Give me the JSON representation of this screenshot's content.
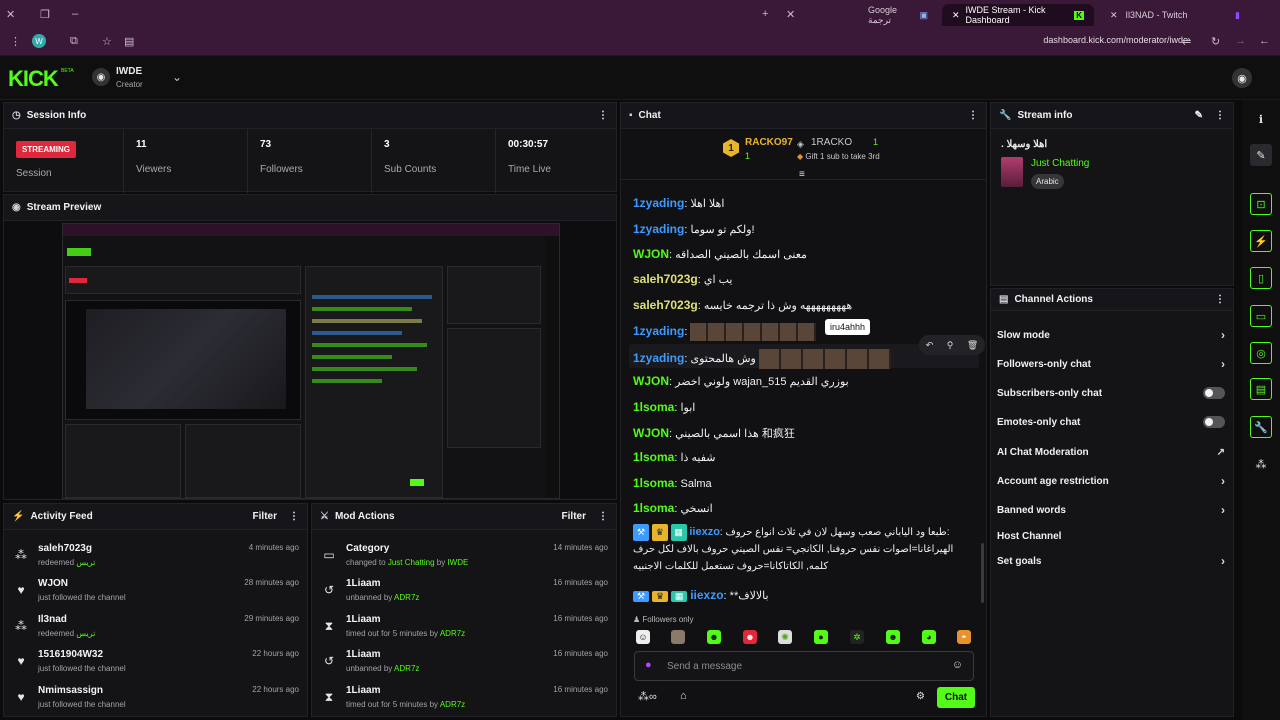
{
  "browser": {
    "tabs": [
      {
        "label": "Google ترجمة"
      },
      {
        "label": "IWDE Stream - Kick Dashboard"
      },
      {
        "label": "Il3NAD - Twitch"
      }
    ],
    "url": "dashboard.kick.com/moderator/iwde",
    "profile_letter": "W"
  },
  "header": {
    "logo": "KICK",
    "logo_badge": "BETA",
    "channel_name": "IWDE",
    "channel_role": "Creator"
  },
  "session": {
    "title": "Session Info",
    "status_badge": "STREAMING",
    "status_label": "Session",
    "stats": [
      {
        "value": "11",
        "label": "Viewers"
      },
      {
        "value": "73",
        "label": "Followers"
      },
      {
        "value": "3",
        "label": "Sub Counts"
      },
      {
        "value": "00:30:57",
        "label": "Time Live"
      }
    ]
  },
  "preview": {
    "title": "Stream Preview"
  },
  "activity": {
    "title": "Activity Feed",
    "filter_label": "Filter",
    "items": [
      {
        "name": "saleh7023g",
        "sub": "redeemed",
        "reward": "تريس",
        "time": "4 minutes ago",
        "icon": "redeem-icon"
      },
      {
        "name": "WJON",
        "sub": "just followed the channel",
        "reward": "",
        "time": "28 minutes ago",
        "icon": "heart-icon"
      },
      {
        "name": "Il3nad",
        "sub": "redeemed",
        "reward": "تريس",
        "time": "29 minutes ago",
        "icon": "redeem-icon"
      },
      {
        "name": "15161904W32",
        "sub": "just followed the channel",
        "reward": "",
        "time": "22 hours ago",
        "icon": "heart-icon"
      },
      {
        "name": "Nmimsassign",
        "sub": "just followed the channel",
        "reward": "",
        "time": "22 hours ago",
        "icon": "heart-icon"
      }
    ]
  },
  "mod": {
    "title": "Mod Actions",
    "filter_label": "Filter",
    "items": [
      {
        "name": "Category",
        "pre": "changed to",
        "target": "Just Chatting",
        "mid": "by",
        "by": "IWDE",
        "time": "14 minutes ago"
      },
      {
        "name": "1Liaam",
        "pre": "unbanned by",
        "target": "ADR7z",
        "mid": "",
        "by": "",
        "time": "16 minutes ago"
      },
      {
        "name": "1Liaam",
        "pre": "timed out for 5 minutes by",
        "target": "ADR7z",
        "mid": "",
        "by": "",
        "time": "16 minutes ago"
      },
      {
        "name": "1Liaam",
        "pre": "unbanned by",
        "target": "ADR7z",
        "mid": "",
        "by": "",
        "time": "16 minutes ago"
      },
      {
        "name": "1Liaam",
        "pre": "timed out for 5 minutes by",
        "target": "ADR7z",
        "mid": "",
        "by": "",
        "time": "16 minutes ago"
      }
    ]
  },
  "chat": {
    "title": "Chat",
    "leader1_name": "RACKO97",
    "leader1_count": "1",
    "leader2_name": "1RACKO",
    "leader2_count": "1",
    "gift_text": "Gift 1 sub to take 3rd",
    "messages": [
      {
        "user": "1zyading",
        "text": "اهلا اهلا",
        "color": "#3d9bff"
      },
      {
        "user": "1zyading",
        "text": "ولكم تو سوما!",
        "color": "#3d9bff"
      },
      {
        "user": "WJON",
        "text": "معنى اسمك بالصيني الصداقه",
        "color": "#53fc18"
      },
      {
        "user": "saleh7023g",
        "text": "يب اي",
        "color": "#dfe07a"
      },
      {
        "user": "saleh7023g",
        "text": "هههههههههه وش ذا ترجمه خايسه",
        "color": "#dfe07a"
      },
      {
        "user": "1zyading",
        "text": "",
        "color": "#3d9bff"
      },
      {
        "user": "1zyading",
        "text": "وش هالمحتوى",
        "color": "#3d9bff"
      },
      {
        "user": "WJON",
        "text": "ولوني اخضر wajan_515 بوزري القديم",
        "color": "#53fc18"
      },
      {
        "user": "1lsoma",
        "text": "ابوا",
        "color": "#53fc18"
      },
      {
        "user": "WJON",
        "text": "هذا اسمي بالصيني 和疯狂",
        "color": "#53fc18"
      },
      {
        "user": "1lsoma",
        "text": "شفيه ذا",
        "color": "#53fc18"
      },
      {
        "user": "1lsoma",
        "text": "Salma",
        "color": "#53fc18"
      },
      {
        "user": "1lsoma",
        "text": "انسخي",
        "color": "#53fc18"
      }
    ],
    "long_msg_user": "iiexzo",
    "long_msg_lines": [
      "طبعا ود الياباني صعب وسهل لان في ثلاث انواع حروف:",
      "الهيراغانا=اصوات نفس حروفنا, الكانجي= نفس الصيني حروف بالاف لكل حرف",
      "كلمه, الكاتاكانا=حروف تستعمل للكلمات الاجنبيه"
    ],
    "last_msg_user": "iiexzo",
    "last_msg_text": "**بالالاف",
    "tooltip": "iru4ahhh",
    "followers_only": "Followers only",
    "input_placeholder": "Send a message",
    "chat_button": "Chat"
  },
  "stream_info": {
    "title": "Stream info",
    "stream_title": ". اهلا وسهلا",
    "category": "Just Chatting",
    "language": "Arabic"
  },
  "channel_actions": {
    "title": "Channel Actions",
    "items": [
      {
        "label": "Slow mode",
        "control": "chevron"
      },
      {
        "label": "Followers-only chat",
        "control": "chevron"
      },
      {
        "label": "Subscribers-only chat",
        "control": "toggle"
      },
      {
        "label": "Emotes-only chat",
        "control": "toggle"
      },
      {
        "label": "AI Chat Moderation",
        "control": "external"
      },
      {
        "label": "Account age restriction",
        "control": "chevron"
      },
      {
        "label": "Banned words",
        "control": "chevron"
      },
      {
        "label": "Host Channel",
        "control": "none"
      },
      {
        "label": "Set goals",
        "control": "chevron"
      }
    ]
  },
  "colors": {
    "accent": "#53fc18",
    "live": "#e1273c",
    "link": "#3d9bff"
  }
}
